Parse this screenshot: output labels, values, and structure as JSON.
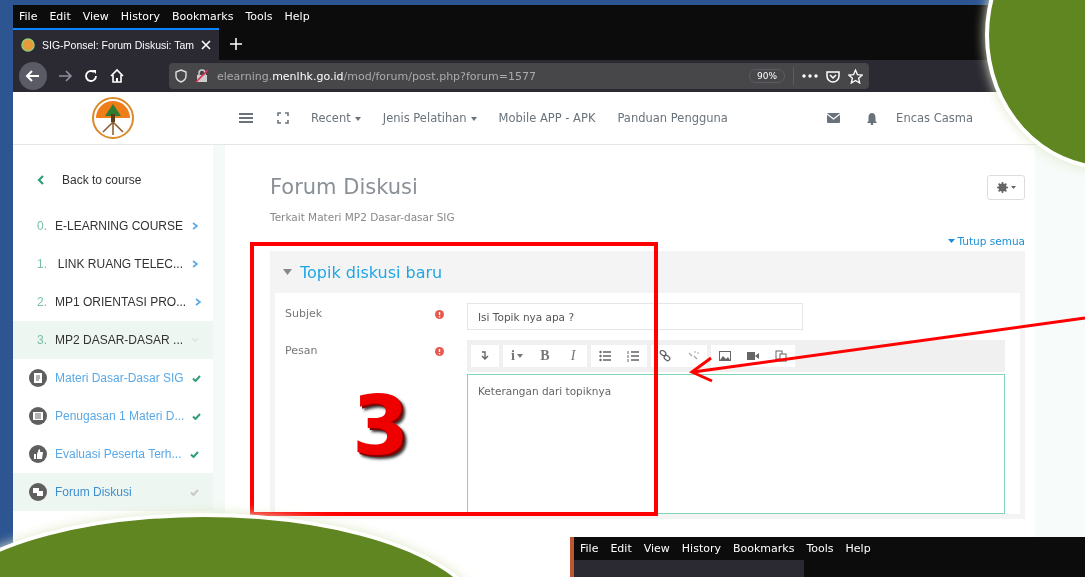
{
  "browser": {
    "menu": [
      "File",
      "Edit",
      "View",
      "History",
      "Bookmarks",
      "Tools",
      "Help"
    ],
    "tab_title": "SIG-Ponsel: Forum Diskusi: Tam",
    "url": "elearning.**menlhk.go.id**/mod/forum/post.php?forum=1577",
    "zoom": "90%"
  },
  "site": {
    "nav": [
      {
        "label": "Recent",
        "dropdown": true
      },
      {
        "label": "Jenis Pelatihan",
        "dropdown": true
      },
      {
        "label": "Mobile APP - APK",
        "dropdown": false
      },
      {
        "label": "Panduan Pengguna",
        "dropdown": false
      }
    ],
    "user": "Encas Casma"
  },
  "sidebar": {
    "back": "Back to course",
    "sections": [
      {
        "number": "0.",
        "label": "E-LEARNING COURSE",
        "expanded": false,
        "selected": false
      },
      {
        "number": "1.",
        "label": "LINK RUANG TELEC...",
        "expanded": false,
        "selected": false
      },
      {
        "number": "2.",
        "label": "MP1 ORIENTASI PRO...",
        "expanded": false,
        "selected": false
      },
      {
        "number": "3.",
        "label": "MP2 DASAR-DASAR ...",
        "expanded": true,
        "selected": true
      }
    ],
    "activities": [
      {
        "kind": "page",
        "label": "Materi Dasar-Dasar SIG",
        "completed": true,
        "selected": false
      },
      {
        "kind": "assignment",
        "label": "Penugasan 1 Materi D...",
        "completed": true,
        "selected": false
      },
      {
        "kind": "feedback",
        "label": "Evaluasi Peserta Terh...",
        "completed": true,
        "selected": false
      },
      {
        "kind": "forum",
        "label": "Forum Diskusi",
        "completed": false,
        "selected": true
      }
    ]
  },
  "page": {
    "title": "Forum Diskusi",
    "subtitle": "Terkait Materi MP2 Dasar-dasar SIG",
    "collapse_all": "Tutup semua",
    "section": {
      "title": "Topik diskusi baru",
      "expanded": true
    },
    "fields": [
      {
        "kind": "text",
        "label": "Subjek",
        "required": true,
        "value": "Isi Topik nya apa ?"
      },
      {
        "kind": "editor",
        "label": "Pesan",
        "required": true,
        "value": "Keterangan dari topiknya"
      }
    ],
    "toolbar": [
      [
        {
          "kind": "collapse"
        }
      ],
      [
        {
          "kind": "styles",
          "glyph": "i"
        },
        {
          "kind": "bold",
          "glyph": "B"
        },
        {
          "kind": "italic",
          "glyph": "I"
        }
      ],
      [
        {
          "kind": "bullets"
        },
        {
          "kind": "numbers"
        }
      ],
      [
        {
          "kind": "link"
        },
        {
          "kind": "unlink"
        }
      ],
      [
        {
          "kind": "image"
        },
        {
          "kind": "video"
        },
        {
          "kind": "files"
        }
      ]
    ]
  },
  "annotation": {
    "step": "3"
  },
  "second_window": {
    "menu": [
      "File",
      "Edit",
      "View",
      "History",
      "Bookmarks",
      "Tools",
      "Help"
    ]
  }
}
